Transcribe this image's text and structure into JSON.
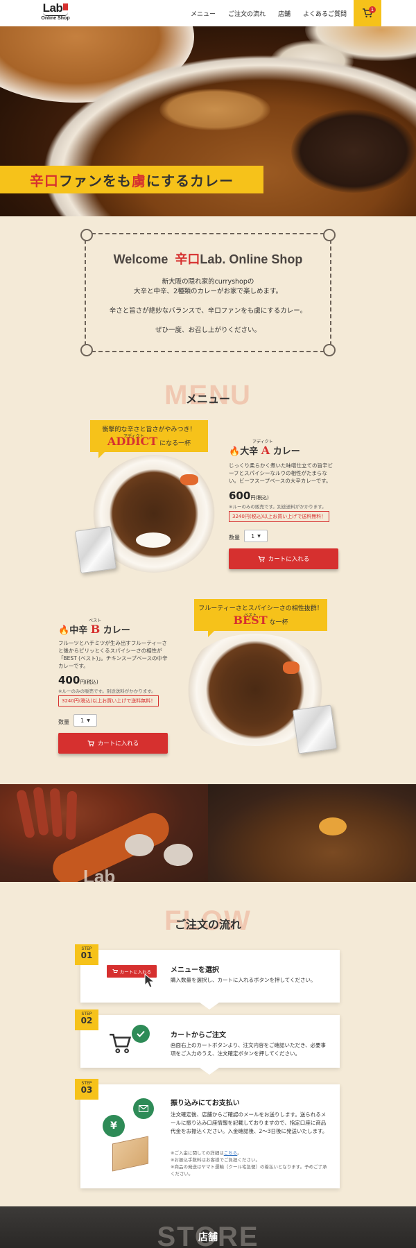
{
  "header": {
    "logo_text": "Lab",
    "logo_sub": "Online Shop",
    "nav": [
      "メニュー",
      "ご注文の流れ",
      "店舗",
      "よくあるご質問"
    ],
    "cart_count": "1",
    "colors": {
      "accent": "#f6c21a",
      "red": "#d6302f"
    }
  },
  "hero": {
    "catch_red1": "辛口",
    "catch_mid": "ファンをも",
    "catch_red2": "虜",
    "catch_end": "にするカレー"
  },
  "welcome": {
    "title_pre": "Welcome",
    "title_red": "辛口",
    "title_post": "Lab. Online Shop",
    "line1": "新大阪の隠れ家的curryshopの",
    "line2": "大辛と中辛、2種類のカレーがお家で楽しめます。",
    "line3": "辛さと旨さが絶妙なバランスで、辛口ファンをも虜にするカレー。",
    "line4": "ぜひ一度、お召し上がりください。"
  },
  "menu_section": {
    "bg_title": "MENU",
    "title": "メニュー"
  },
  "item_a": {
    "tag_line1": "衝撃的な辛さと旨さがやみつき！",
    "tag_ruby": "アディクト",
    "tag_big": "ADDICT",
    "tag_suffix": "になる一杯",
    "name_pre": "大辛",
    "name_letter": "A",
    "name_ruby": "アディクト",
    "name_post": "カレー",
    "desc": "じっくり柔らかく煮いた味噌仕立ての旨辛ビーフとスパイシーなルウの相性がたまらない。ビーフスープベースの大辛カレーです。",
    "price": "600",
    "price_unit": "円(税込)",
    "note": "※ルーのみの販売です。別途送料がかかります。",
    "free": "3240円(税込)以上お買い上げで送料無料！",
    "qty_label": "数量",
    "qty_value": "1",
    "button": "カートに入れる"
  },
  "item_b": {
    "tag_line1": "フルーティーさとスパイシーさの相性抜群！",
    "tag_ruby": "ベスト",
    "tag_big": "BEST",
    "tag_suffix": "な一杯",
    "name_pre": "中辛",
    "name_letter": "B",
    "name_ruby": "ベスト",
    "name_post": "カレー",
    "desc": "フルーツとハチミツが生み出すフルーティーさと後からピリッとくるスパイシーさの相性が「BEST (ベスト)」。チキンスープベースの中辛カレーです。",
    "price": "400",
    "price_unit": "円(税込)",
    "note": "※ルーのみの販売です。別途送料がかかります。",
    "free": "3240円(税込)以上お買い上げで送料無料！",
    "qty_label": "数量",
    "qty_value": "1",
    "button": "カートに入れる"
  },
  "strip": {
    "logo_text": "Lab"
  },
  "flow_section": {
    "bg_title": "FLOW",
    "title": "ご注文の流れ"
  },
  "steps": [
    {
      "label": "STEP",
      "num": "01",
      "title": "メニューを選択",
      "body": "購入数量を選択し、カートに入れるボタンを押してください。",
      "mini_button": "カートに入れる"
    },
    {
      "label": "STEP",
      "num": "02",
      "title": "カートからご注文",
      "body": "画面右上のカートボタンより、注文内容をご確認いただき、必要事項をご入力のうえ、注文確定ボタンを押してください。"
    },
    {
      "label": "STEP",
      "num": "03",
      "title": "振り込みにてお支払い",
      "body": "注文確定後、店舗からご確認のメールをお送りします。送られるメールに振り込み口座情報を記載しておりますので、指定口座に商品代金をお振込ください。入金確認後、2～3日後に発送いたします。",
      "note1_pre": "※ご入金に関しての詳細は",
      "note1_link": "こちら",
      "note1_post": "。",
      "note2": "※お振込手数料はお客様でご負担ください。",
      "note3": "※商品の発送はヤマト運輸（クール宅急便）の着払いとなります。予めご了承ください。",
      "yen": "¥"
    }
  ],
  "store_section": {
    "bg_title": "STORE",
    "title": "店舗"
  }
}
